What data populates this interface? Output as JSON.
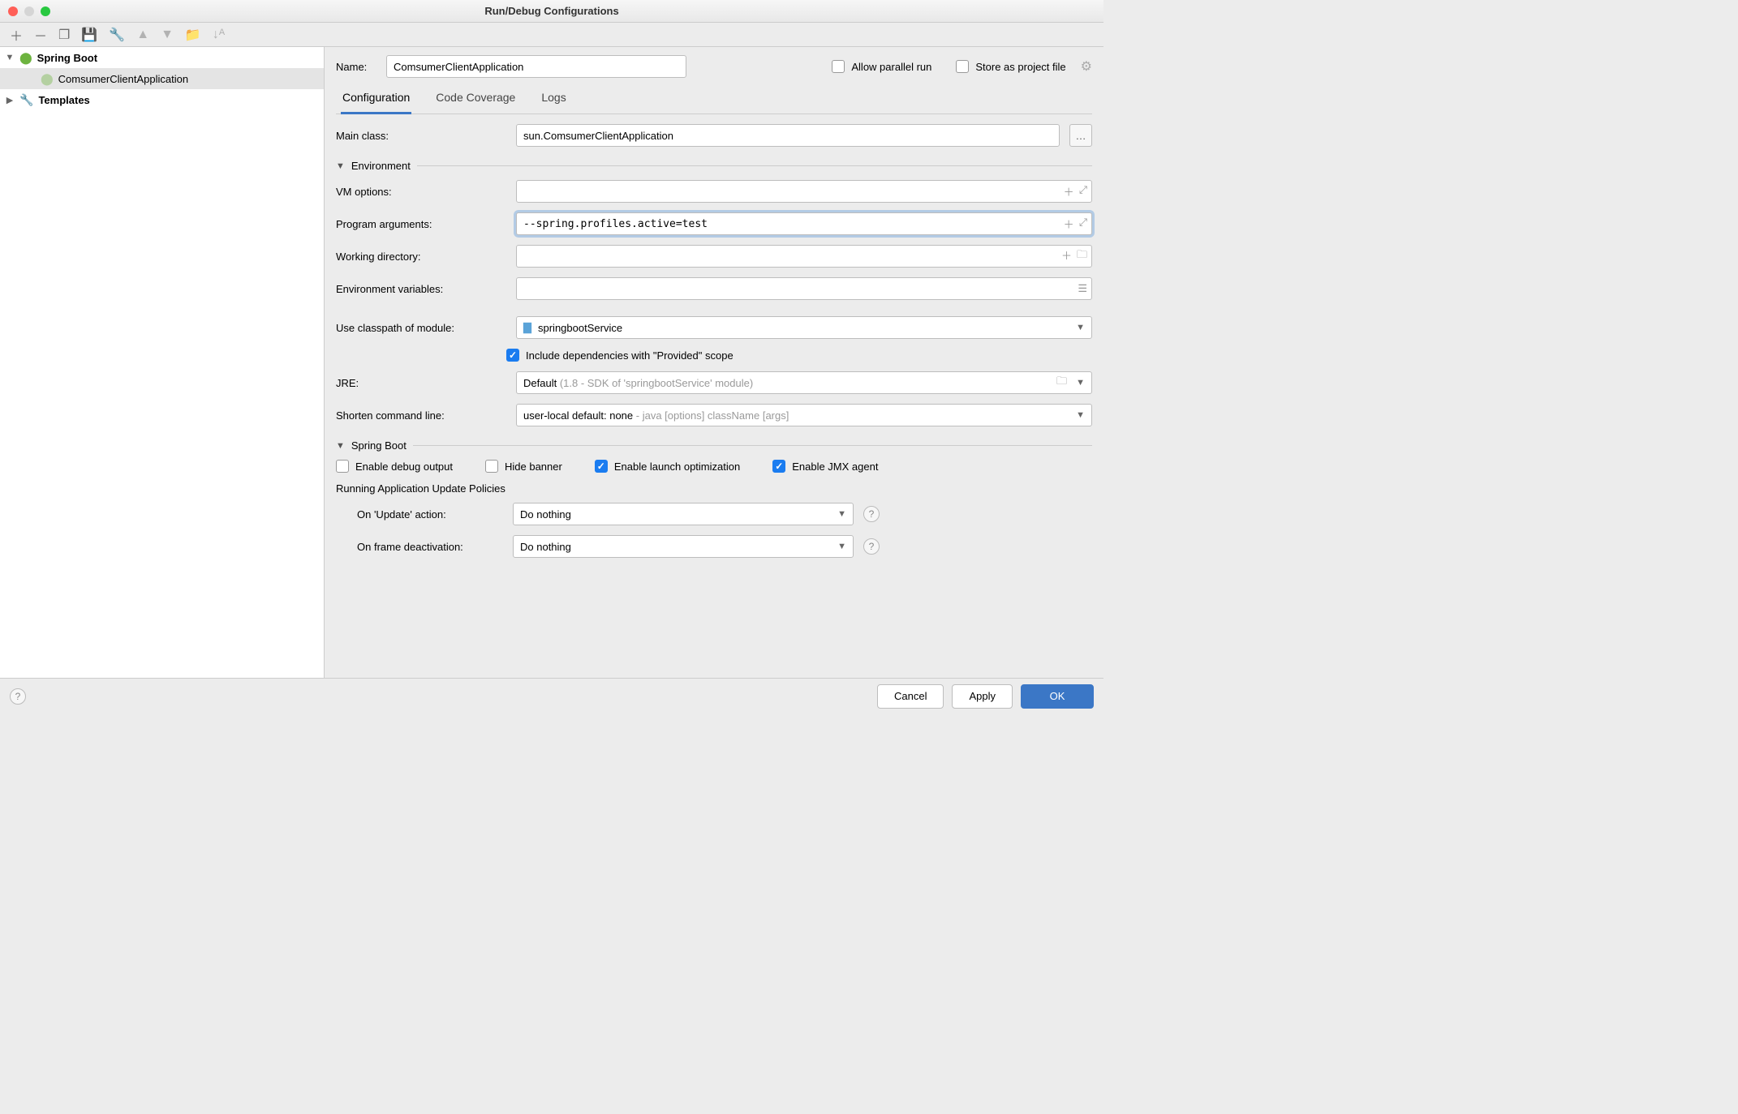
{
  "title": "Run/Debug Configurations",
  "tree": {
    "root1": "Spring Boot",
    "item1": "ComsumerClientApplication",
    "root2": "Templates"
  },
  "header": {
    "name_lbl": "Name:",
    "name_val": "ComsumerClientApplication",
    "allow_parallel": "Allow parallel run",
    "store_project": "Store as project file"
  },
  "tabs": {
    "config": "Configuration",
    "coverage": "Code Coverage",
    "logs": "Logs"
  },
  "section_env": "Environment",
  "section_boot": "Spring Boot",
  "fields": {
    "main_class_lbl": "Main class:",
    "main_class_val": "sun.ComsumerClientApplication",
    "vm_lbl": "VM options:",
    "vm_val": "",
    "args_lbl": "Program arguments:",
    "args_val": "--spring.profiles.active=test",
    "wd_lbl": "Working directory:",
    "wd_val": "",
    "env_lbl": "Environment variables:",
    "env_val": "",
    "cp_lbl": "Use classpath of module:",
    "cp_val": "springbootService",
    "include_provided": "Include dependencies with \"Provided\" scope",
    "jre_lbl": "JRE:",
    "jre_val": "Default ",
    "jre_hint": "(1.8 - SDK of 'springbootService' module)",
    "shorten_lbl": "Shorten command line:",
    "shorten_val": "user-local default: none ",
    "shorten_hint": "- java [options] className [args]"
  },
  "boot": {
    "debug": "Enable debug output",
    "hide": "Hide banner",
    "launch": "Enable launch optimization",
    "jmx": "Enable JMX agent",
    "policies": "Running Application Update Policies",
    "on_update_lbl": "On 'Update' action:",
    "on_update_val": "Do nothing",
    "on_frame_lbl": "On frame deactivation:",
    "on_frame_val": "Do nothing"
  },
  "footer": {
    "cancel": "Cancel",
    "apply": "Apply",
    "ok": "OK"
  }
}
